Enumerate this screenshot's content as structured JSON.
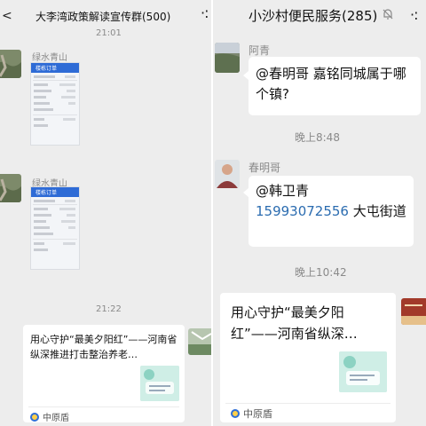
{
  "left": {
    "back_glyph": "<",
    "title": "大李湾政策解读宣传群(500)",
    "more_glyph": "·:",
    "time1": "21:01",
    "sender": "绿水青山",
    "screenshot_header": "楼栋订单",
    "time2": "21:22",
    "link_title": "用心守护“最美夕阳红”——河南省纵深推进打击整治养老…",
    "link_source": "中原盾"
  },
  "right": {
    "title": "小沙村便民服务(285)",
    "more_glyph": "·:",
    "msg1_sender": "阿青",
    "msg1_text": "@春明哥  嘉铭同城属于哪个镇?",
    "time1": "晚上8:48",
    "msg2_sender": "春明哥",
    "msg2_mention": "@韩卫青",
    "msg2_phone": "15993072556",
    "msg2_rest": " 大屯街道",
    "time2": "晚上10:42",
    "link_title": "用心守护“最美夕阳红”——河南省纵深…",
    "link_source": "中原盾"
  },
  "icons": {
    "back": "chevron-left-icon",
    "more": "more-icon",
    "mute": "bell-mute-icon",
    "source_logo": "zhongyuandun-logo-icon"
  }
}
